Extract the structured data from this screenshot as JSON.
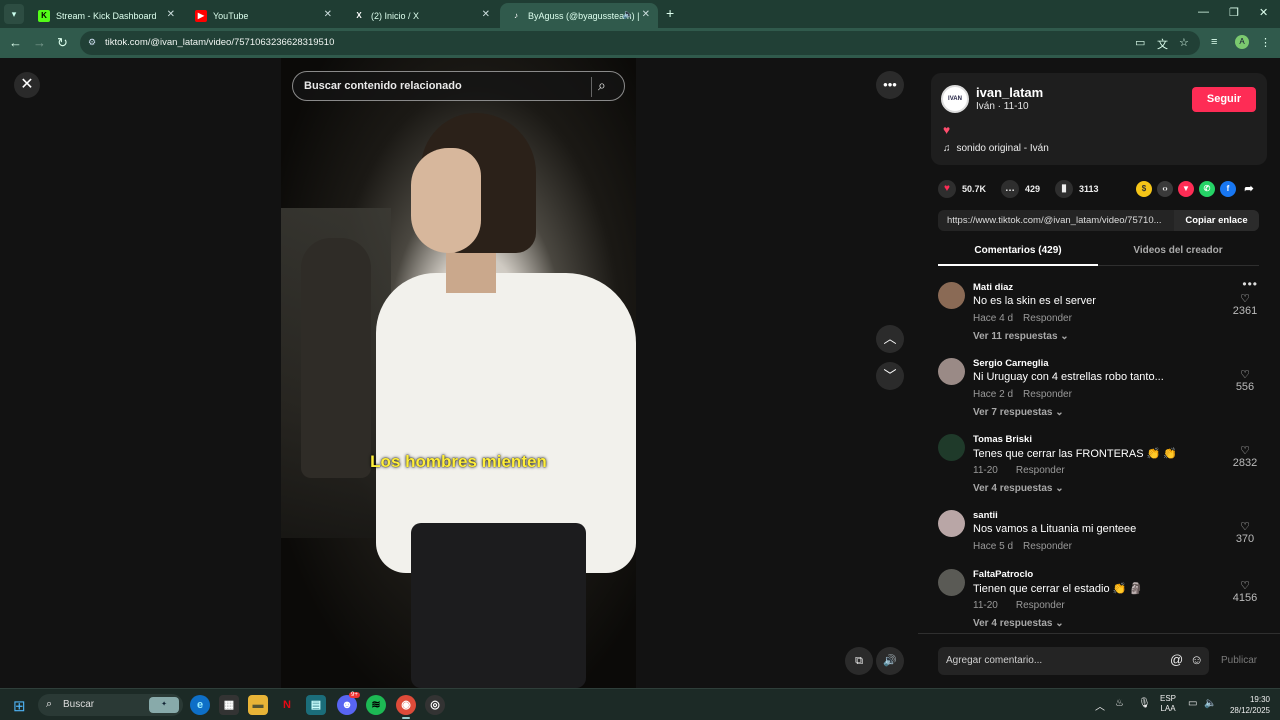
{
  "browser": {
    "tabs": [
      {
        "title": "Stream - Kick Dashboard",
        "favicon": "kick-icon",
        "active": false
      },
      {
        "title": "YouTube",
        "favicon": "youtube-icon",
        "active": false
      },
      {
        "title": "(2) Inicio / X",
        "favicon": "x-icon",
        "active": false
      },
      {
        "title": "ByAguss (@byagussteam) |",
        "favicon": "tiktok-icon",
        "active": true
      }
    ],
    "url": "tiktok.com/@ivan_latam/video/7571063236628319510",
    "profile_initial": "A"
  },
  "video": {
    "search_placeholder": "Buscar contenido relacionado",
    "caption": "Los hombres mienten"
  },
  "author": {
    "username": "ivan_latam",
    "subtitle": "Iván · 11-10",
    "avatar_text": "IVAN",
    "follow_label": "Seguir",
    "description_emoji": "♥",
    "sound": "sonido original - Iván"
  },
  "stats": {
    "likes": "50.7K",
    "comments": "429",
    "saves": "3113"
  },
  "link": {
    "url": "https://www.tiktok.com/@ivan_latam/video/75710...",
    "copy_label": "Copiar enlace"
  },
  "panel_tabs": {
    "comments": "Comentarios (429)",
    "creator_videos": "Videos del creador"
  },
  "comments": [
    {
      "user": "Mati diaz",
      "text": "No es la skin es el server",
      "time": "Hace 4 d",
      "reply": "Responder",
      "replies": "Ver 11 respuestas",
      "likes": "2361",
      "avatar_color": "#8a6a55"
    },
    {
      "user": "Sergio Carneglia",
      "text": "Ni Uruguay con 4 estrellas robo tanto...",
      "time": "Hace 2 d",
      "reply": "Responder",
      "replies": "Ver 7 respuestas",
      "likes": "556",
      "avatar_color": "#9a8a86"
    },
    {
      "user": "Tomas Briski",
      "text": "Tenes que cerrar las FRONTERAS 👏 👏",
      "time": "11-20",
      "reply": "Responder",
      "replies": "Ver 4 respuestas",
      "likes": "2832",
      "avatar_color": "#1f3a2a"
    },
    {
      "user": "santii",
      "text": "Nos vamos a Lituania mi genteee",
      "time": "Hace 5 d",
      "reply": "Responder",
      "replies": "",
      "likes": "370",
      "avatar_color": "#b9a6a6"
    },
    {
      "user": "FaltaPatroclo",
      "text": "Tienen que cerrar el estadio 👏 🗿",
      "time": "11-20",
      "reply": "Responder",
      "replies": "Ver 4 respuestas",
      "likes": "4156",
      "avatar_color": "#5a5a55"
    }
  ],
  "comment_box": {
    "placeholder": "Agregar comentario...",
    "publish_label": "Publicar"
  },
  "taskbar": {
    "search_label": "Buscar",
    "language": "ESP",
    "keyboard": "LAA",
    "time": "19:30",
    "date": "28/12/2025",
    "discord_badge": "9+"
  },
  "colors": {
    "follow": "#fe2c55",
    "caption": "#ffef3a",
    "browser_chrome": "#305a4c"
  }
}
